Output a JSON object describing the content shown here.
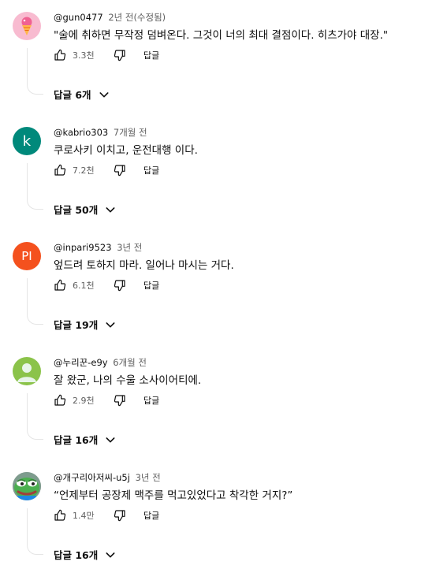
{
  "actions": {
    "reply_label": "답글"
  },
  "comments": [
    {
      "handle": "@gun0477",
      "time": "2년 전(수정됨)",
      "text": "\"술에 취하면 무작정 덤벼온다. 그것이 너의 최대 결점이다. 히츠가야 대장.\"",
      "likes": "3.3천",
      "replies": "답글 6개",
      "avatar": {
        "icon": "ice-cream-icon",
        "bg": "#f8bbd0"
      }
    },
    {
      "handle": "@kabrio303",
      "time": "7개월 전",
      "text": "쿠로사키 이치고, 운전대행 이다.",
      "likes": "7.2천",
      "replies": "답글 50개",
      "avatar": {
        "letter": "k",
        "bg": "#00897b"
      }
    },
    {
      "handle": "@inpari9523",
      "time": "3년 전",
      "text": "엎드려 토하지 마라. 일어나 마시는 거다.",
      "likes": "6.1천",
      "replies": "답글 19개",
      "avatar": {
        "letter": "PI",
        "bg": "#f4511e"
      }
    },
    {
      "handle": "@누리꾼-e9y",
      "time": "6개월 전",
      "text": "잘 왔군, 나의 수울 소사이어티에.",
      "likes": "2.9천",
      "replies": "답글 16개",
      "avatar": {
        "icon": "default-user-icon",
        "bg": "#8bc34a"
      }
    },
    {
      "handle": "@개구리아저씨-u5j",
      "time": "3년 전",
      "text": "“언제부터 공장제 맥주를 먹고있었다고 착각한 거지?”",
      "likes": "1.4만",
      "replies": "답글 16개",
      "avatar": {
        "icon": "frog-icon",
        "bg": "#9e9e9e"
      }
    }
  ]
}
